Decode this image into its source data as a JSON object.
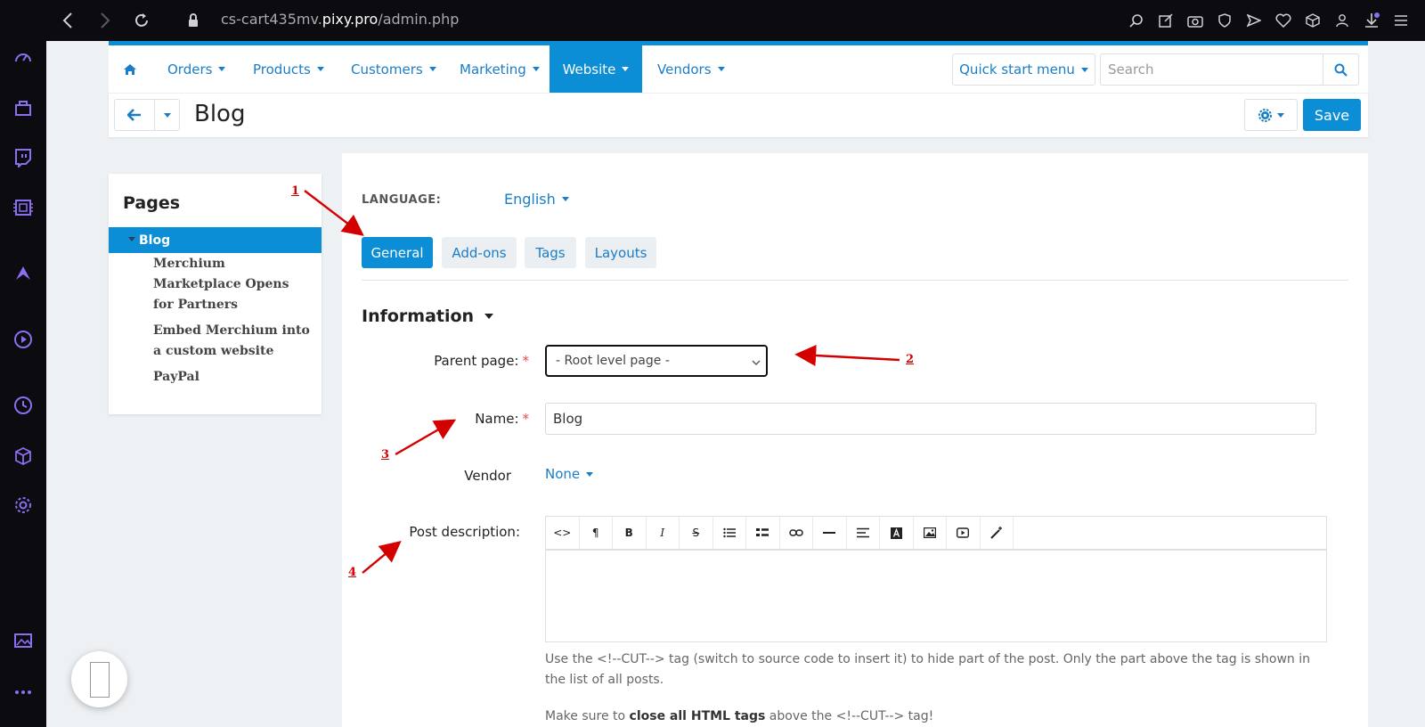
{
  "browser": {
    "url_prefix": "cs-cart435mv.",
    "url_host": "pixy.pro",
    "url_path": "/admin.php"
  },
  "nav": {
    "orders": "Orders",
    "products": "Products",
    "customers": "Customers",
    "marketing": "Marketing",
    "website": "Website",
    "vendors": "Vendors",
    "quick_start": "Quick start menu",
    "search_placeholder": "Search"
  },
  "title_bar": {
    "title": "Blog",
    "save": "Save"
  },
  "pages_panel": {
    "title": "Pages",
    "active": "Blog",
    "items": [
      "Merchium Marketplace Opens for Partners",
      "Embed Merchium into a custom website",
      "PayPal"
    ]
  },
  "main": {
    "language_label": "LANGUAGE:",
    "language_value": "English",
    "tabs": [
      "General",
      "Add-ons",
      "Tags",
      "Layouts"
    ],
    "section_title": "Information",
    "parent_page_label": "Parent page:",
    "parent_page_value": "- Root level page -",
    "name_label": "Name:",
    "name_value": "Blog",
    "vendor_label": "Vendor",
    "vendor_value": "None",
    "post_description_label": "Post description:",
    "required_mark": "*",
    "help_text": "Use the <!--CUT--> tag (switch to source code to insert it) to hide part of the post. Only the part above the tag is shown in the list of all posts.",
    "help_text2_pre": "Make sure to ",
    "help_text2_bold": "close all HTML tags",
    "help_text2_post": " above the <!--CUT--> tag!"
  },
  "toolbar_buttons": [
    "code-icon",
    "paragraph-icon",
    "bold-icon",
    "italic-icon",
    "strikethrough-icon",
    "unordered-list-icon",
    "ordered-list-icon",
    "link-icon",
    "horizontal-rule-icon",
    "align-icon",
    "font-color-icon",
    "image-icon",
    "video-icon",
    "magic-wand-icon"
  ],
  "annotations": [
    "1",
    "2",
    "3",
    "4"
  ],
  "colors": {
    "accent": "#0b8ed6",
    "link": "#1a7ec7",
    "annotation": "#d40000",
    "chrome": "#0c0b10"
  }
}
